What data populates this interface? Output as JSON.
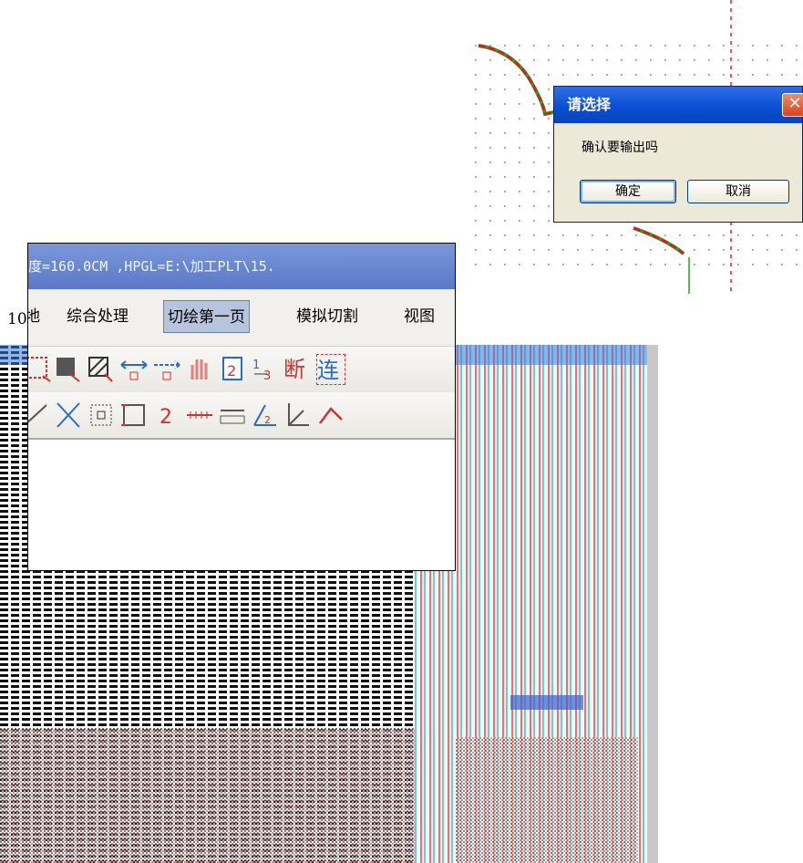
{
  "dialog": {
    "title": "请选择",
    "message": "确认要输出吗",
    "ok_label": "确定",
    "cancel_label": "取消",
    "close_icon": "close-icon",
    "colors": {
      "titlebar": "#0b4fd3",
      "body": "#ece9d8",
      "close": "#d9431d"
    }
  },
  "toolbar_window": {
    "title_text": "度=160.0CM ,HPGL=E:\\加工PLT\\15.",
    "menu": [
      {
        "label": "地"
      },
      {
        "label": "综合处理"
      },
      {
        "label": "切绘第一页"
      },
      {
        "label": "模拟切割"
      },
      {
        "label": "视图"
      }
    ],
    "selected_menu": "切绘第一页",
    "icons_row_1": [
      "select-rect-icon",
      "fill-rect-icon",
      "hatch-rect-icon",
      "arrow-both-icon",
      "arrow-right-icon",
      "hand-icon",
      "page-2-icon",
      "number-order-icon",
      "break-icon",
      "connect-icon"
    ],
    "icons_row_2": [
      "diagonal-line-icon",
      "cross-icon",
      "grid-target-icon",
      "bounding-box-icon",
      "number-2-icon",
      "dimension-icon",
      "ruler-icon",
      "angle-2-icon",
      "angle-icon",
      "caret-icon"
    ],
    "break_label": "断",
    "connect_label": "连",
    "left_label": "10"
  }
}
